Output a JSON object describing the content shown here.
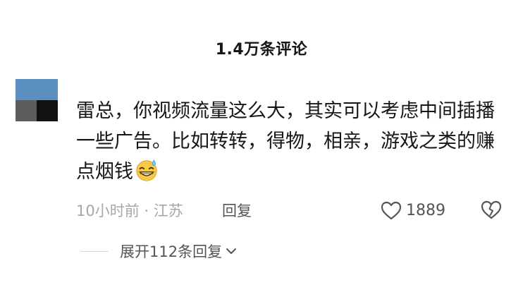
{
  "header": {
    "title": "1.4万条评论"
  },
  "comment": {
    "text": "雷总，你视频流量这么大，其实可以考虑中间插播一些广告。比如转转，得物，相亲，游戏之类的赚点烟钱",
    "emoji": "grinning-sweat-emoji",
    "meta": "10小时前 · 江苏",
    "reply_label": "回复",
    "like_count": "1889",
    "icons": {
      "like": "heart-outline-icon",
      "dislike": "broken-heart-icon",
      "expand": "chevron-down-icon"
    }
  },
  "replies": {
    "expand_label": "展开112条回复"
  },
  "colors": {
    "primary_text": "#161616",
    "secondary_text": "#555557",
    "muted_text": "#a7a7ab",
    "avatar_blue": "#5b8fc0",
    "avatar_dark": "#111111",
    "avatar_gray": "#5d5d5f"
  }
}
